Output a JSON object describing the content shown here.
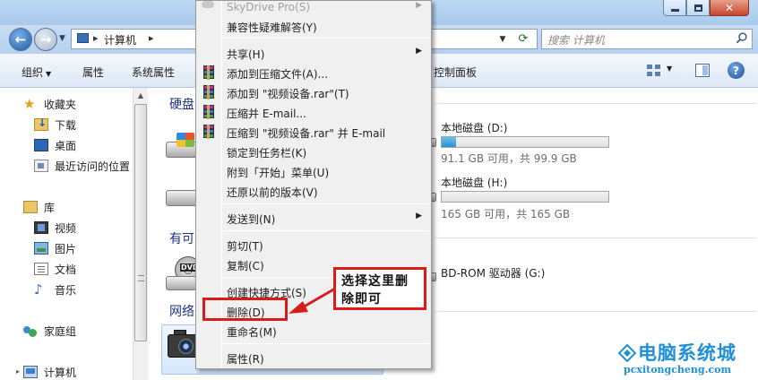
{
  "window": {
    "address_path": "计算机",
    "search_placeholder": "搜索 计算机"
  },
  "toolbar": {
    "organize_label": "组织",
    "properties_label": "属性",
    "system_properties_label": "系统属性",
    "control_panel_label": "控制面板"
  },
  "nav": {
    "favorites": "收藏夹",
    "downloads": "下载",
    "desktop": "桌面",
    "recent_places": "最近访问的位置",
    "libraries": "库",
    "videos": "视频",
    "pictures": "图片",
    "documents": "文档",
    "music": "音乐",
    "homegroup": "家庭组",
    "computer": "计算机"
  },
  "content": {
    "group_hdd": "硬盘",
    "group_removable": "有可",
    "group_network": "网络",
    "drives": [
      {
        "name": "本地磁盘 (D:)",
        "free_text": "91.1 GB 可用，共 99.9 GB",
        "used_fraction": 0.088
      },
      {
        "name": "本地磁盘 (H:)",
        "free_text": "165 GB 可用，共 165 GB",
        "used_fraction": 0.0
      }
    ],
    "dvd_drive": "BD-ROM 驱动器 (G:)",
    "dvd_badge": "DVD"
  },
  "context_menu": {
    "items": [
      {
        "label": "SkyDrive Pro(S)",
        "disabled": true,
        "submenu": true
      },
      {
        "label": "兼容性疑难解答(Y)"
      },
      {
        "label": "共享(H)",
        "submenu": true
      },
      {
        "label": "添加到压缩文件(A)..."
      },
      {
        "label": "添加到 \"视频设备.rar\"(T)"
      },
      {
        "label": "压缩并 E-mail..."
      },
      {
        "label": "压缩到 \"视频设备.rar\" 并 E-mail"
      },
      {
        "label": "锁定到任务栏(K)"
      },
      {
        "label": "附到「开始」菜单(U)"
      },
      {
        "label": "还原以前的版本(V)"
      },
      {
        "label": "发送到(N)",
        "submenu": true
      },
      {
        "label": "剪切(T)"
      },
      {
        "label": "复制(C)"
      },
      {
        "label": "创建快捷方式(S)"
      },
      {
        "label": "删除(D)"
      },
      {
        "label": "重命名(M)"
      },
      {
        "label": "属性(R)"
      }
    ],
    "submenu_glyph": "▶"
  },
  "callout": {
    "line1": "选择这里删",
    "line2": "除即可"
  },
  "watermark": {
    "title": "电脑系统城",
    "url": "pcxitongcheng.com"
  },
  "colors": {
    "highlight_red": "#d81c1c",
    "watermark_blue": "#1f8fd6",
    "group_header": "#1e3287"
  }
}
